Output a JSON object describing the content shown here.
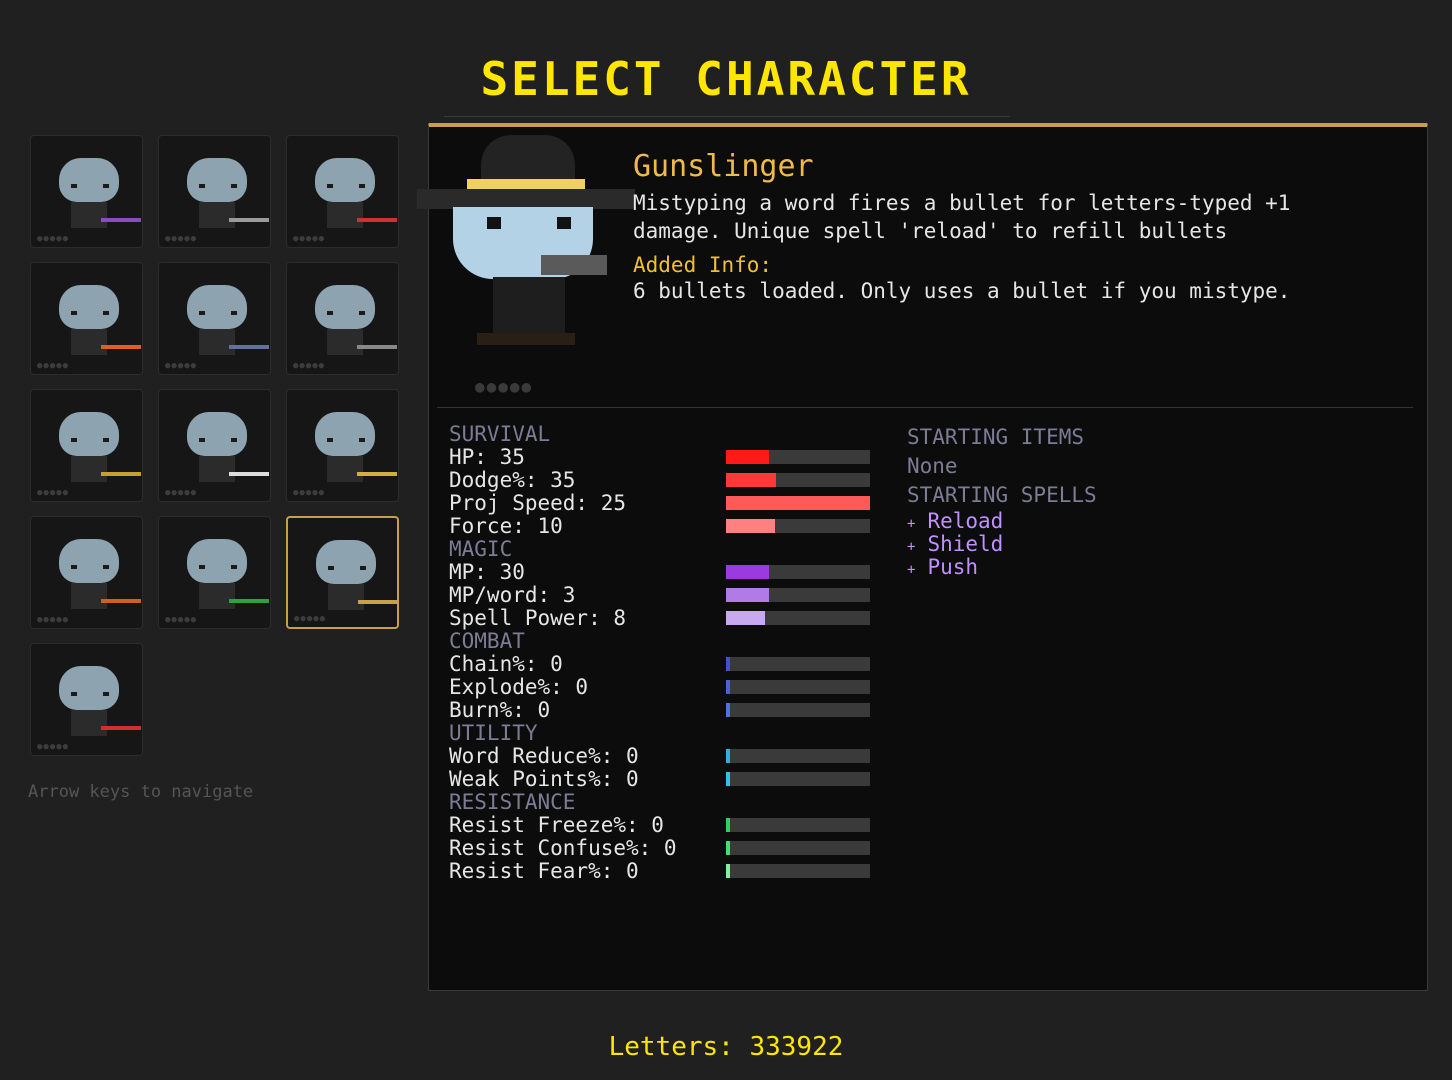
{
  "title": "SELECT CHARACTER",
  "hint": "Arrow keys to navigate",
  "colors": {
    "accent_gold": "#c8a04a",
    "title_yellow": "#ffe600",
    "name_orange": "#f0b94a",
    "category_gray": "#7c7c95",
    "spell_purple": "#c090ff"
  },
  "grid": {
    "slots": [
      {
        "name": "character-slot-1",
        "weapon_color": "#8a4cc0",
        "icon": "staff-icon"
      },
      {
        "name": "character-slot-2",
        "weapon_color": "#9a9a9a",
        "icon": "hood-icon"
      },
      {
        "name": "character-slot-3",
        "weapon_color": "#d03030",
        "icon": "goggles-icon"
      },
      {
        "name": "character-slot-4",
        "weapon_color": "#e06020",
        "icon": "wizard-hat-icon"
      },
      {
        "name": "character-slot-5",
        "weapon_color": "#6070a0",
        "icon": "knight-helmet-icon"
      },
      {
        "name": "character-slot-6",
        "weapon_color": "#888888",
        "icon": "ninja-mask-icon"
      },
      {
        "name": "character-slot-7",
        "weapon_color": "#c8a030",
        "icon": "bow-icon"
      },
      {
        "name": "character-slot-8",
        "weapon_color": "#dddddd",
        "icon": "fox-icon"
      },
      {
        "name": "character-slot-9",
        "weapon_color": "#d0b040",
        "icon": "bug-icon"
      },
      {
        "name": "character-slot-10",
        "weapon_color": "#d06020",
        "icon": "headband-icon"
      },
      {
        "name": "character-slot-11",
        "weapon_color": "#30a040",
        "icon": "scarf-icon"
      },
      {
        "name": "character-slot-12",
        "weapon_color": "#c8a04a",
        "icon": "cowboy-hat-icon",
        "selected": true
      },
      {
        "name": "character-slot-13",
        "weapon_color": "#d03030",
        "icon": "sword-icon"
      }
    ]
  },
  "character": {
    "name": "Gunslinger",
    "description": "Mistyping a word fires a bullet for letters-typed +1 damage. Unique spell 'reload' to refill bullets",
    "added_info_label": "Added Info:",
    "added_info": "6 bullets loaded. Only uses a bullet if you mistype.",
    "portrait_dots": "●●●●●"
  },
  "stats": {
    "survival": {
      "label": "SURVIVAL",
      "rows": [
        {
          "label": "HP: 35",
          "value": 0.3,
          "color": "#ff1a1a"
        },
        {
          "label": "Dodge%: 35",
          "value": 0.35,
          "color": "#ff3838"
        },
        {
          "label": "Proj Speed: 25",
          "value": 1.0,
          "color": "#ff5a5a"
        },
        {
          "label": "Force: 10",
          "value": 0.34,
          "color": "#ff8080"
        }
      ]
    },
    "magic": {
      "label": "MAGIC",
      "rows": [
        {
          "label": "MP: 30",
          "value": 0.3,
          "color": "#9a3ae0"
        },
        {
          "label": "MP/word: 3",
          "value": 0.3,
          "color": "#b07ae8"
        },
        {
          "label": "Spell Power: 8",
          "value": 0.27,
          "color": "#c8a8f0"
        }
      ]
    },
    "combat": {
      "label": "COMBAT",
      "rows": [
        {
          "label": "Chain%: 0",
          "value": 0.02,
          "color": "#4050d0"
        },
        {
          "label": "Explode%: 0",
          "value": 0.02,
          "color": "#4a62d8"
        },
        {
          "label": "Burn%: 0",
          "value": 0.02,
          "color": "#5072e0"
        }
      ]
    },
    "utility": {
      "label": "UTILITY",
      "rows": [
        {
          "label": "Word Reduce%: 0",
          "value": 0.02,
          "color": "#30b0e0"
        },
        {
          "label": "Weak Points%: 0",
          "value": 0.02,
          "color": "#30c0e8"
        }
      ]
    },
    "resistance": {
      "label": "RESISTANCE",
      "rows": [
        {
          "label": "Resist Freeze%: 0",
          "value": 0.02,
          "color": "#30d060"
        },
        {
          "label": "Resist Confuse%: 0",
          "value": 0.02,
          "color": "#40e070"
        },
        {
          "label": "Resist Fear%: 0",
          "value": 0.02,
          "color": "#80f0a0"
        }
      ]
    }
  },
  "starting": {
    "items_label": "STARTING ITEMS",
    "items_value": "None",
    "spells_label": "STARTING SPELLS",
    "spells": [
      "Reload",
      "Shield",
      "Push"
    ],
    "bullet": "+"
  },
  "letters": "Letters: 333922"
}
